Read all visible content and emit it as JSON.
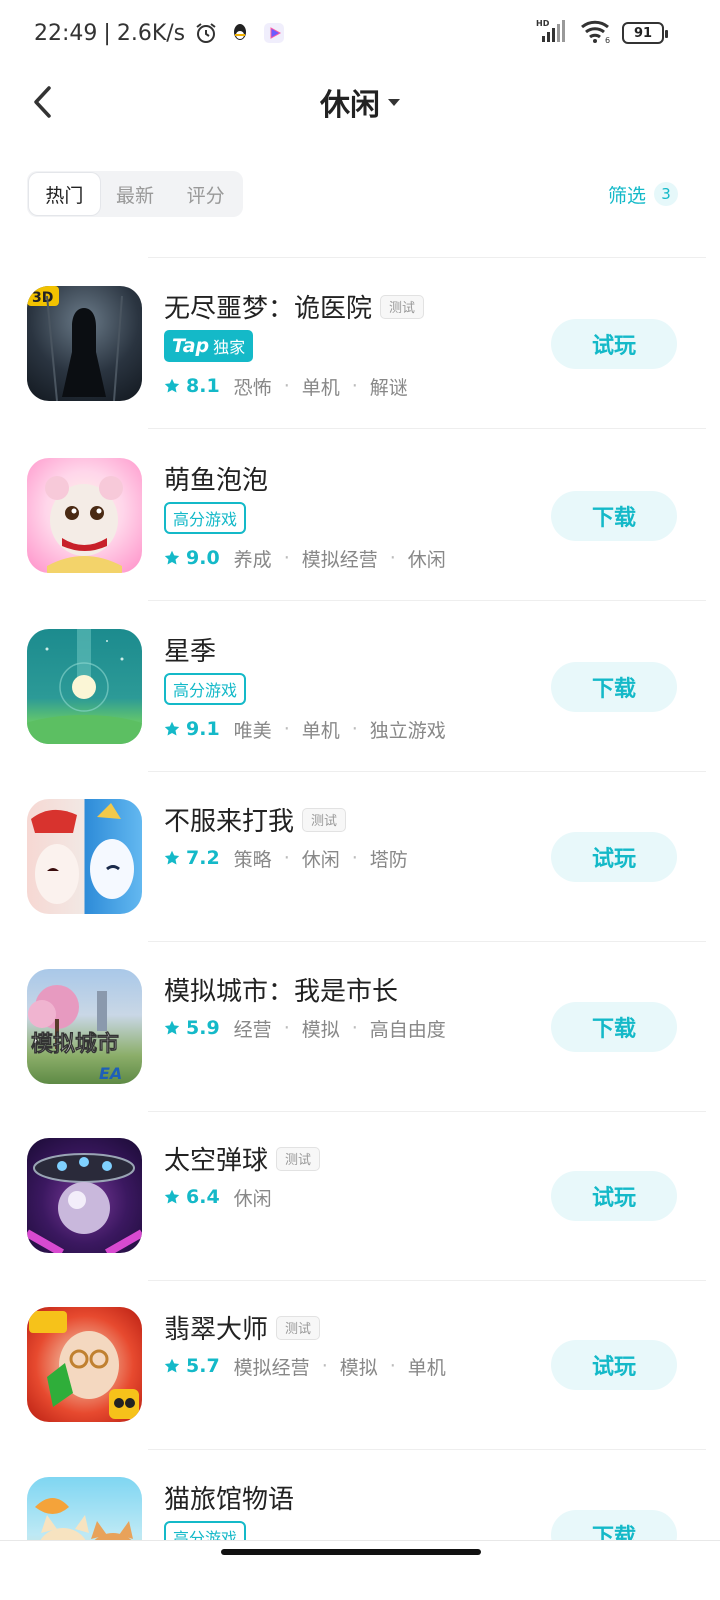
{
  "status_bar": {
    "time": "22:49",
    "speed": "2.6K/s",
    "battery": "91",
    "signal_label": "HD",
    "wifi_label": "6"
  },
  "header": {
    "title": "休闲"
  },
  "tabs": [
    {
      "label": "热门",
      "active": true
    },
    {
      "label": "最新",
      "active": false
    },
    {
      "label": "评分",
      "active": false
    }
  ],
  "filter": {
    "label": "筛选",
    "count": "3"
  },
  "icons": {
    "star": "star-icon",
    "back": "chevron-left-icon",
    "caret": "caret-down-icon"
  },
  "colors": {
    "accent": "#14b9c8",
    "button_bg": "#e8f8fa"
  },
  "games": [
    {
      "name": "无尽噩梦：诡医院",
      "test_badge": "测试",
      "tag_tap_word": "Tap",
      "tag_tap_text": "独家",
      "rating": "8.1",
      "tags": [
        "恐怖",
        "单机",
        "解谜"
      ],
      "action": "试玩",
      "icon_badge": "3D"
    },
    {
      "name": "萌鱼泡泡",
      "tag_high": "高分游戏",
      "rating": "9.0",
      "tags": [
        "养成",
        "模拟经营",
        "休闲"
      ],
      "action": "下载"
    },
    {
      "name": "星季",
      "tag_high": "高分游戏",
      "rating": "9.1",
      "tags": [
        "唯美",
        "单机",
        "独立游戏"
      ],
      "action": "下载"
    },
    {
      "name": "不服来打我",
      "test_badge": "测试",
      "rating": "7.2",
      "tags": [
        "策略",
        "休闲",
        "塔防"
      ],
      "action": "试玩"
    },
    {
      "name": "模拟城市：我是市长",
      "rating": "5.9",
      "tags": [
        "经营",
        "模拟",
        "高自由度"
      ],
      "action": "下载",
      "icon_text": "模拟城市",
      "icon_brand": "EA"
    },
    {
      "name": "太空弹球",
      "test_badge": "测试",
      "rating": "6.4",
      "tags": [
        "休闲"
      ],
      "action": "试玩"
    },
    {
      "name": "翡翠大师",
      "test_badge": "测试",
      "rating": "5.7",
      "tags": [
        "模拟经营",
        "模拟",
        "单机"
      ],
      "action": "试玩"
    },
    {
      "name": "猫旅馆物语",
      "tag_high": "高分游戏",
      "action": "下载"
    }
  ]
}
